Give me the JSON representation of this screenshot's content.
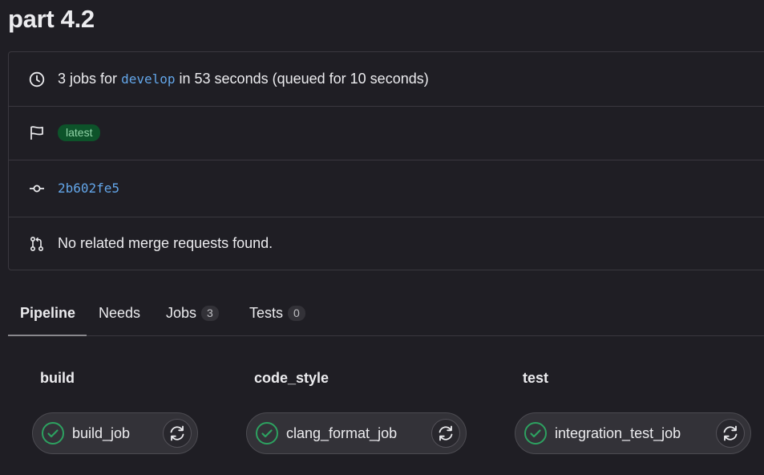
{
  "page": {
    "title": "part 4.2"
  },
  "info": {
    "jobs_prefix": "3 jobs for",
    "branch": "develop",
    "jobs_suffix": "in 53 seconds (queued for 10 seconds)",
    "badge": "latest",
    "commit_sha": "2b602fe5",
    "merge_requests": "No related merge requests found."
  },
  "tabs": [
    {
      "label": "Pipeline"
    },
    {
      "label": "Needs"
    },
    {
      "label": "Jobs",
      "count": "3"
    },
    {
      "label": "Tests",
      "count": "0"
    }
  ],
  "stages": [
    {
      "name": "build",
      "job": "build_job"
    },
    {
      "name": "code_style",
      "job": "clang_format_job"
    },
    {
      "name": "test",
      "job": "integration_test_job"
    }
  ],
  "colors": {
    "success": "#2da160",
    "link": "#63a6e9",
    "badge_bg": "#0d532a"
  },
  "icons": {
    "duration": "clock-icon",
    "badges": "flag-icon",
    "commit": "commit-icon",
    "merge_request": "merge-request-icon",
    "job_status": "status-success-icon",
    "retry": "retry-icon"
  }
}
